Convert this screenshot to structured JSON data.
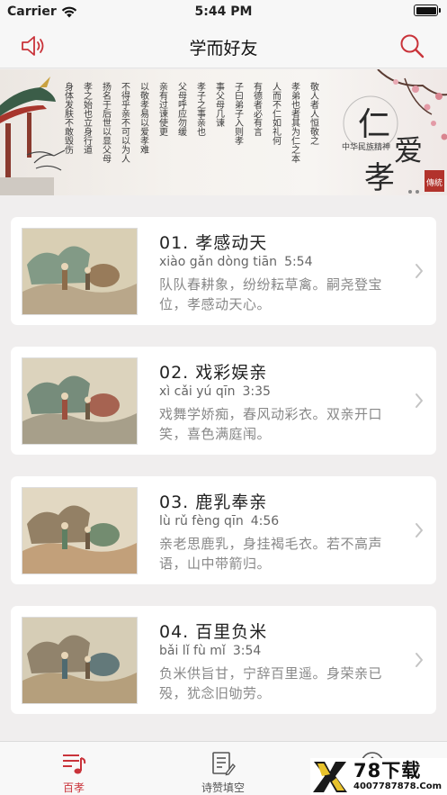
{
  "status": {
    "carrier": "Carrier",
    "time": "5:44 PM"
  },
  "nav": {
    "title": "学而好友",
    "left_icon": "speaker-icon",
    "right_icon": "search-icon"
  },
  "banner": {
    "motto_chars": [
      "仁",
      "爱",
      "孝"
    ],
    "subtitle": "中华民族精神",
    "seal": "傳統",
    "columns": [
      "身体发肤不敢毁伤",
      "孝之始也立身行道",
      "扬名于后世以显父母",
      "不得乎亲不可以为人",
      "以敬孝易以爱孝难",
      "亲有过谏使更",
      "父母呼应勿缓",
      "孝子之事亲也",
      "事父母几谏",
      "子曰弟子入则孝",
      "有德者必有言",
      "人而不仁如礼何",
      "孝弟也者其为仁之本",
      "敬人者人恒敬之"
    ]
  },
  "stories": [
    {
      "title": "01. 孝感动天",
      "pinyin": "xiào gǎn dòng tiān",
      "duration": "5:54",
      "desc": "队队春耕象，纷纷耘草禽。嗣尧登宝位，孝感动天心。"
    },
    {
      "title": "02. 戏彩娱亲",
      "pinyin": "xì cǎi yú qīn",
      "duration": "3:35",
      "desc": "戏舞学娇痴，春风动彩衣。双亲开口笑，喜色满庭闱。"
    },
    {
      "title": "03. 鹿乳奉亲",
      "pinyin": "lù rǔ fèng qīn",
      "duration": "4:56",
      "desc": "亲老思鹿乳，身挂褐毛衣。若不高声语，山中带箭归。"
    },
    {
      "title": "04. 百里负米",
      "pinyin": "bǎi lǐ fù mǐ",
      "duration": "3:54",
      "desc": "负米供旨甘，宁辞百里遥。身荣亲已殁，犹念旧劬劳。"
    }
  ],
  "tabs": [
    {
      "label": "百孝",
      "icon": "music-list-icon",
      "active": true
    },
    {
      "label": "诗赞填空",
      "icon": "edit-document-icon",
      "active": false
    },
    {
      "label": "",
      "icon": "info-icon",
      "active": false
    }
  ],
  "watermark": {
    "big": "78下载",
    "small": "4007787878.Com"
  },
  "colors": {
    "accent": "#c9333a",
    "background": "#f0eeee",
    "card": "#ffffff"
  }
}
